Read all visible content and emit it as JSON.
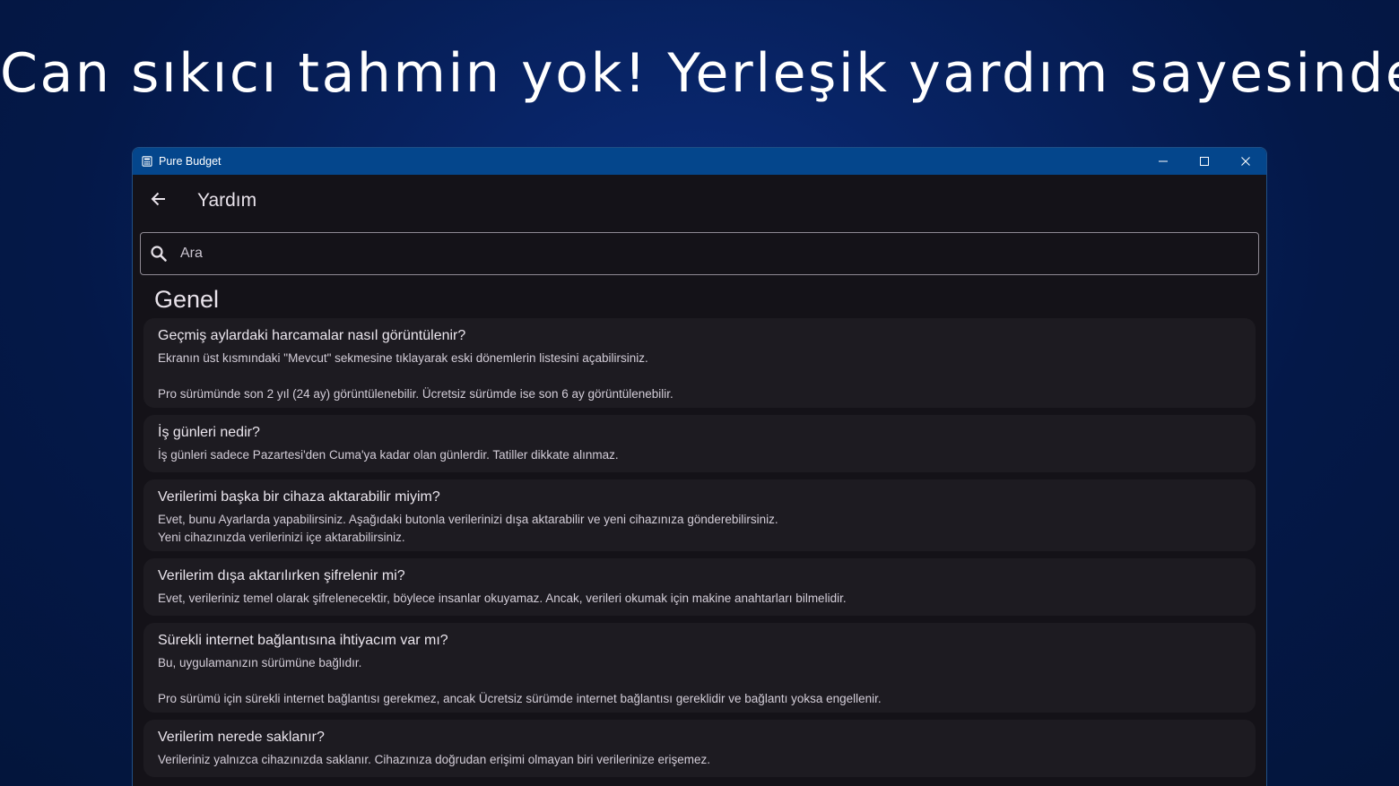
{
  "headline": "Can sıkıcı tahmin yok! Yerleşik yardım sayesinde!",
  "colors": {
    "background": "#06205a",
    "titlebar": "#04468c",
    "window_bg": "#141218",
    "card_bg": "#1d1b21",
    "text_primary": "#ebe6ee",
    "text_secondary": "#d3cdd8"
  },
  "window": {
    "title": "Pure Budget",
    "app_icon": "calculator-icon",
    "controls": [
      "minimize-icon",
      "maximize-icon",
      "close-icon"
    ]
  },
  "appbar": {
    "back_icon": "arrow-left-icon",
    "title": "Yardım"
  },
  "search": {
    "icon": "search-icon",
    "placeholder": "Ara",
    "value": ""
  },
  "section": {
    "title": "Genel"
  },
  "faq": [
    {
      "question": "Geçmiş aylardaki harcamalar nasıl görüntülenir?",
      "answer": "Ekranın üst kısmındaki \"Mevcut\" sekmesine tıklayarak eski dönemlerin listesini açabilirsiniz.\n\nPro sürümünde son 2 yıl (24 ay) görüntülenebilir. Ücretsiz sürümde ise son 6 ay görüntülenebilir."
    },
    {
      "question": "İş günleri nedir?",
      "answer": "İş günleri sadece Pazartesi'den Cuma'ya kadar olan günlerdir. Tatiller dikkate alınmaz."
    },
    {
      "question": "Verilerimi başka bir cihaza aktarabilir miyim?",
      "answer": "Evet, bunu Ayarlarda yapabilirsiniz. Aşağıdaki butonla verilerinizi dışa aktarabilir ve yeni cihazınıza gönderebilirsiniz.\nYeni cihazınızda verilerinizi içe aktarabilirsiniz."
    },
    {
      "question": "Verilerim dışa aktarılırken şifrelenir mi?",
      "answer": "Evet, verileriniz temel olarak şifrelenecektir, böylece insanlar okuyamaz. Ancak, verileri okumak için makine anahtarları bilmelidir."
    },
    {
      "question": "Sürekli internet bağlantısına ihtiyacım var mı?",
      "answer": "Bu, uygulamanızın sürümüne bağlıdır.\n\nPro sürümü için sürekli internet bağlantısı gerekmez, ancak Ücretsiz sürümde internet bağlantısı gereklidir ve bağlantı yoksa engellenir."
    },
    {
      "question": "Verilerim nerede saklanır?",
      "answer": "Verileriniz yalnızca cihazınızda saklanır. Cihazınıza doğrudan erişimi olmayan biri verilerinize erişemez."
    }
  ]
}
